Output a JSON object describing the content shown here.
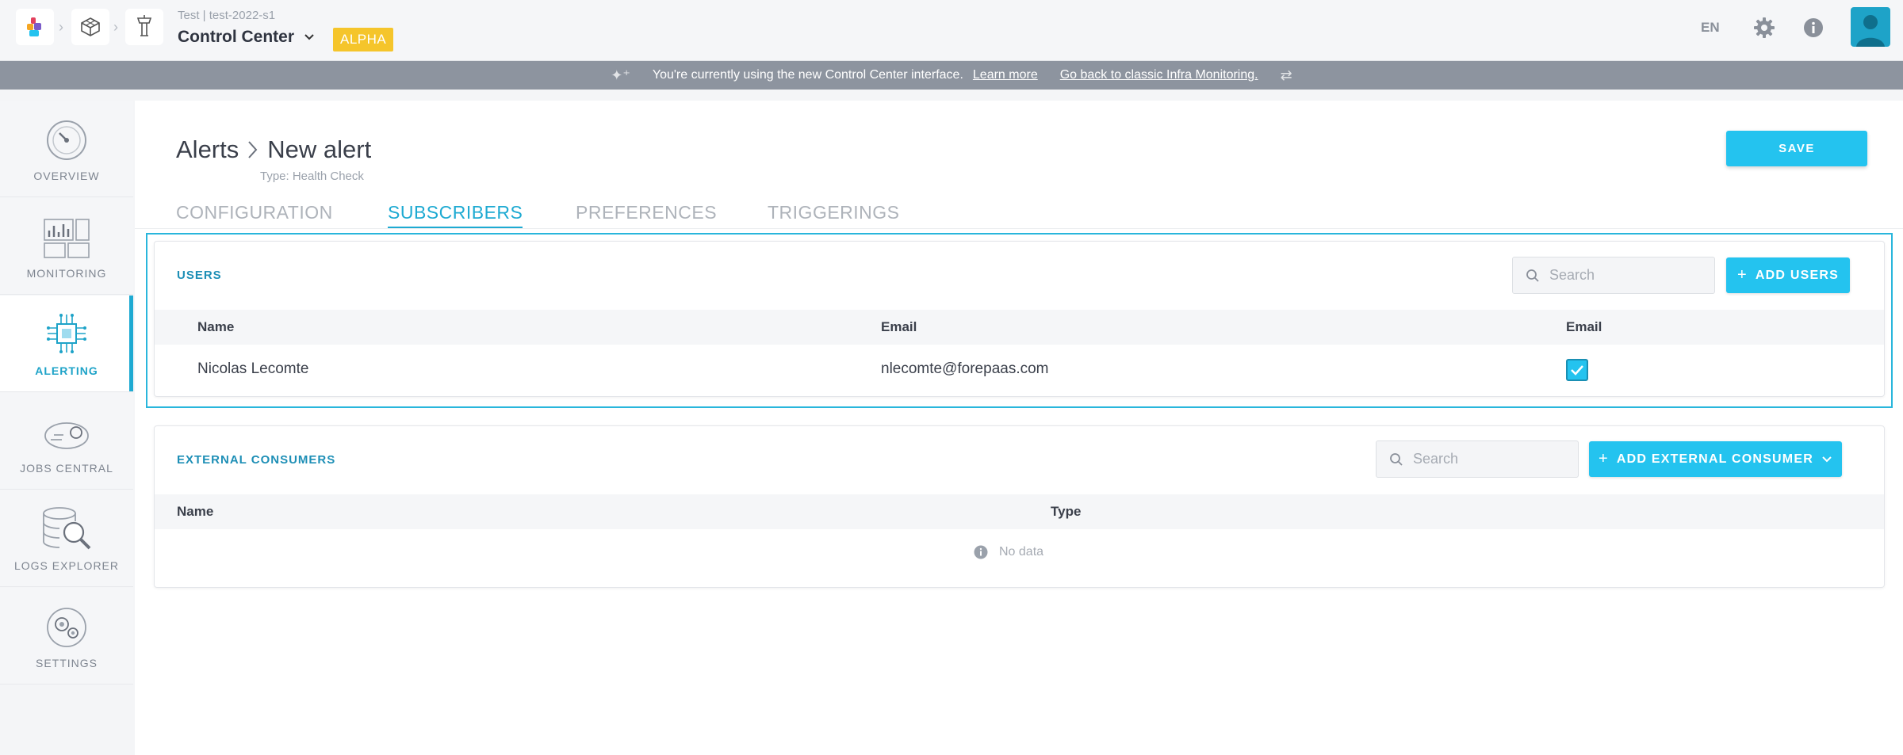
{
  "topbar": {
    "project_sub": "Test | test-2022-s1",
    "project_title": "Control Center",
    "badge": "ALPHA",
    "language": "EN"
  },
  "banner": {
    "message": "You're currently using the new Control Center interface.",
    "learn_more": "Learn more",
    "go_back": "Go back to classic Infra Monitoring."
  },
  "sidebar": {
    "items": [
      {
        "label": "OVERVIEW",
        "icon": "gauge-icon"
      },
      {
        "label": "MONITORING",
        "icon": "dashboard-icon"
      },
      {
        "label": "ALERTING",
        "icon": "chip-icon"
      },
      {
        "label": "JOBS CENTRAL",
        "icon": "jobs-icon"
      },
      {
        "label": "LOGS EXPLORER",
        "icon": "database-search-icon"
      },
      {
        "label": "SETTINGS",
        "icon": "settings-gear-icon"
      }
    ]
  },
  "page": {
    "breadcrumb_parent": "Alerts",
    "title": "New alert",
    "type": "Type: Health Check",
    "save_label": "SAVE",
    "tabs": [
      "CONFIGURATION",
      "SUBSCRIBERS",
      "PREFERENCES",
      "TRIGGERINGS"
    ],
    "active_tab": "SUBSCRIBERS"
  },
  "users": {
    "title": "USERS",
    "search_placeholder": "Search",
    "add_label": "ADD USERS",
    "columns": [
      "Name",
      "Email",
      "Email"
    ],
    "rows": [
      {
        "name": "Nicolas Lecomte",
        "email": "nlecomte@forepaas.com",
        "email_notify": true
      }
    ]
  },
  "external": {
    "title": "EXTERNAL CONSUMERS",
    "search_placeholder": "Search",
    "add_label": "ADD EXTERNAL CONSUMER",
    "columns": [
      "Name",
      "Type"
    ],
    "empty": "No data"
  },
  "colors": {
    "accent": "#24c3ef",
    "accent_dark": "#1eaad2",
    "badge": "#f5c52b",
    "banner": "#8d949f"
  }
}
